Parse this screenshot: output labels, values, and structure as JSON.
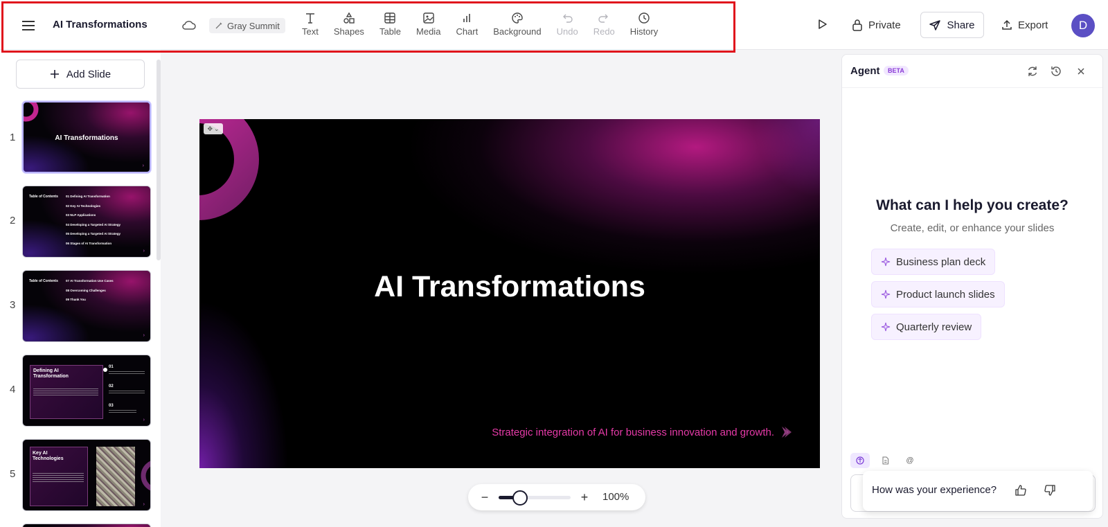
{
  "toolbar": {
    "doc_title": "AI Transformations",
    "theme_name": "Gray Summit",
    "tools": [
      {
        "label": "Text",
        "icon": "text-icon"
      },
      {
        "label": "Shapes",
        "icon": "shapes-icon"
      },
      {
        "label": "Table",
        "icon": "table-icon"
      },
      {
        "label": "Media",
        "icon": "media-icon"
      },
      {
        "label": "Chart",
        "icon": "chart-icon"
      },
      {
        "label": "Background",
        "icon": "palette-icon"
      },
      {
        "label": "Undo",
        "icon": "undo-icon"
      },
      {
        "label": "Redo",
        "icon": "redo-icon"
      },
      {
        "label": "History",
        "icon": "history-icon"
      }
    ],
    "private_label": "Private",
    "share_label": "Share",
    "export_label": "Export",
    "avatar_initial": "D"
  },
  "sidebar": {
    "add_slide_label": "Add Slide",
    "slides": [
      {
        "num": "1",
        "title": "AI Transformations"
      },
      {
        "num": "2",
        "title": "Table of Contents",
        "items": [
          "01  Defining AI Transformation",
          "02  Key AI Technologies",
          "03  NLP Applications",
          "04  Developing a Targeted AI Strategy",
          "05  Developing a Targeted AI Strategy",
          "06  Stages of AI Transformation"
        ]
      },
      {
        "num": "3",
        "title": "Table of Contents",
        "items": [
          "07  AI Transformation Use Cases",
          "08  Overcoming Challenges",
          "09  Thank You"
        ]
      },
      {
        "num": "4",
        "title": "Defining AI Transformation",
        "points": [
          "01",
          "02",
          "03"
        ]
      },
      {
        "num": "5",
        "title": "Key AI Technologies"
      }
    ]
  },
  "slide": {
    "title": "AI Transformations",
    "subtitle": "Strategic integration of AI for business innovation and growth."
  },
  "zoom": {
    "value_label": "100%",
    "minus": "−",
    "plus": "+",
    "level_fraction": 0.3
  },
  "agent": {
    "title": "Agent",
    "badge": "BETA",
    "help_title": "What can I help you create?",
    "help_subtitle": "Create, edit, or enhance your slides",
    "suggestions": [
      "Business plan deck",
      "Product launch slides",
      "Quarterly review"
    ],
    "mode_at": "@"
  },
  "feedback": {
    "question": "How was your experience?"
  },
  "colors": {
    "accent": "#5b4fc4",
    "highlight": "#e0121c",
    "slide_subtitle": "#e63aa8"
  }
}
